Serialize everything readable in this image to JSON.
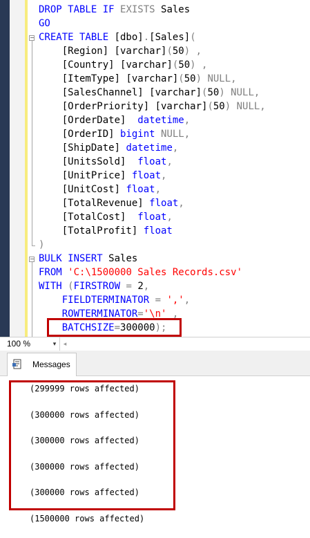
{
  "editor": {
    "code_lines": [
      [
        {
          "t": "DROP TABLE IF ",
          "c": "kw"
        },
        {
          "t": "EXISTS",
          "c": "gr"
        },
        {
          "t": " Sales",
          "c": ""
        }
      ],
      [
        {
          "t": "GO",
          "c": "kw"
        }
      ],
      [
        {
          "t": "CREATE TABLE ",
          "c": "kw"
        },
        {
          "t": "[dbo]",
          "c": ""
        },
        {
          "t": ".",
          "c": "gr"
        },
        {
          "t": "[Sales]",
          "c": ""
        },
        {
          "t": "(",
          "c": "gr"
        }
      ],
      [
        {
          "t": "    [Region] ",
          "c": ""
        },
        {
          "t": "[varchar]",
          "c": ""
        },
        {
          "t": "(",
          "c": "gr"
        },
        {
          "t": "50",
          "c": ""
        },
        {
          "t": ") ,",
          "c": "gr"
        }
      ],
      [
        {
          "t": "    [Country] ",
          "c": ""
        },
        {
          "t": "[varchar]",
          "c": ""
        },
        {
          "t": "(",
          "c": "gr"
        },
        {
          "t": "50",
          "c": ""
        },
        {
          "t": ") ,",
          "c": "gr"
        }
      ],
      [
        {
          "t": "    [ItemType] ",
          "c": ""
        },
        {
          "t": "[varchar]",
          "c": ""
        },
        {
          "t": "(",
          "c": "gr"
        },
        {
          "t": "50",
          "c": ""
        },
        {
          "t": ") NULL,",
          "c": "gr"
        }
      ],
      [
        {
          "t": "    [SalesChannel] ",
          "c": ""
        },
        {
          "t": "[varchar]",
          "c": ""
        },
        {
          "t": "(",
          "c": "gr"
        },
        {
          "t": "50",
          "c": ""
        },
        {
          "t": ") NULL,",
          "c": "gr"
        }
      ],
      [
        {
          "t": "    [OrderPriority] ",
          "c": ""
        },
        {
          "t": "[varchar]",
          "c": ""
        },
        {
          "t": "(",
          "c": "gr"
        },
        {
          "t": "50",
          "c": ""
        },
        {
          "t": ") NULL,",
          "c": "gr"
        }
      ],
      [
        {
          "t": "    [OrderDate]  ",
          "c": ""
        },
        {
          "t": "datetime",
          "c": "kw"
        },
        {
          "t": ",",
          "c": "gr"
        }
      ],
      [
        {
          "t": "    [OrderID] ",
          "c": ""
        },
        {
          "t": "bigint",
          "c": "kw"
        },
        {
          "t": " NULL,",
          "c": "gr"
        }
      ],
      [
        {
          "t": "    [ShipDate] ",
          "c": ""
        },
        {
          "t": "datetime",
          "c": "kw"
        },
        {
          "t": ",",
          "c": "gr"
        }
      ],
      [
        {
          "t": "    [UnitsSold]  ",
          "c": ""
        },
        {
          "t": "float",
          "c": "kw"
        },
        {
          "t": ",",
          "c": "gr"
        }
      ],
      [
        {
          "t": "    [UnitPrice] ",
          "c": ""
        },
        {
          "t": "float",
          "c": "kw"
        },
        {
          "t": ",",
          "c": "gr"
        }
      ],
      [
        {
          "t": "    [UnitCost] ",
          "c": ""
        },
        {
          "t": "float",
          "c": "kw"
        },
        {
          "t": ",",
          "c": "gr"
        }
      ],
      [
        {
          "t": "    [TotalRevenue] ",
          "c": ""
        },
        {
          "t": "float",
          "c": "kw"
        },
        {
          "t": ",",
          "c": "gr"
        }
      ],
      [
        {
          "t": "    [TotalCost]  ",
          "c": ""
        },
        {
          "t": "float",
          "c": "kw"
        },
        {
          "t": ",",
          "c": "gr"
        }
      ],
      [
        {
          "t": "    [TotalProfit] ",
          "c": ""
        },
        {
          "t": "float",
          "c": "kw"
        }
      ],
      [
        {
          "t": ")",
          "c": "gr"
        }
      ],
      [
        {
          "t": "BULK INSERT ",
          "c": "kw"
        },
        {
          "t": "Sales",
          "c": ""
        }
      ],
      [
        {
          "t": "FROM ",
          "c": "kw"
        },
        {
          "t": "'C:\\1500000 Sales Records.csv'",
          "c": "str"
        }
      ],
      [
        {
          "t": "WITH ",
          "c": "kw"
        },
        {
          "t": "(",
          "c": "gr"
        },
        {
          "t": "FIRSTROW ",
          "c": "kw"
        },
        {
          "t": "= ",
          "c": "gr"
        },
        {
          "t": "2",
          "c": ""
        },
        {
          "t": ",",
          "c": "gr"
        }
      ],
      [
        {
          "t": "    FIELDTERMINATOR ",
          "c": "kw"
        },
        {
          "t": "= ",
          "c": "gr"
        },
        {
          "t": "','",
          "c": "str"
        },
        {
          "t": ",",
          "c": "gr"
        }
      ],
      [
        {
          "t": "    ROWTERMINATOR",
          "c": "kw"
        },
        {
          "t": "=",
          "c": "gr"
        },
        {
          "t": "'\\n'",
          "c": "str"
        },
        {
          "t": " ,",
          "c": "gr"
        }
      ],
      [
        {
          "t": "    BATCHSIZE",
          "c": "kw"
        },
        {
          "t": "=",
          "c": "gr"
        },
        {
          "t": "300000",
          "c": ""
        },
        {
          "t": ");",
          "c": "gr"
        }
      ]
    ],
    "fold_minus": "−"
  },
  "zoom": {
    "value": "100 %",
    "dropdown_glyph": "▾",
    "scroll_left_glyph": "◂"
  },
  "results": {
    "tab_label": "Messages",
    "tab_icon": "messages-icon",
    "messages": [
      "(299999 rows affected)",
      "(300000 rows affected)",
      "(300000 rows affected)",
      "(300000 rows affected)",
      "(300000 rows affected)",
      "(1500000 rows affected)"
    ]
  },
  "colors": {
    "keyword": "#0000ff",
    "operator": "#808080",
    "string": "#ff0000",
    "highlight": "#c00000",
    "change_bar": "#f7ec7e"
  }
}
